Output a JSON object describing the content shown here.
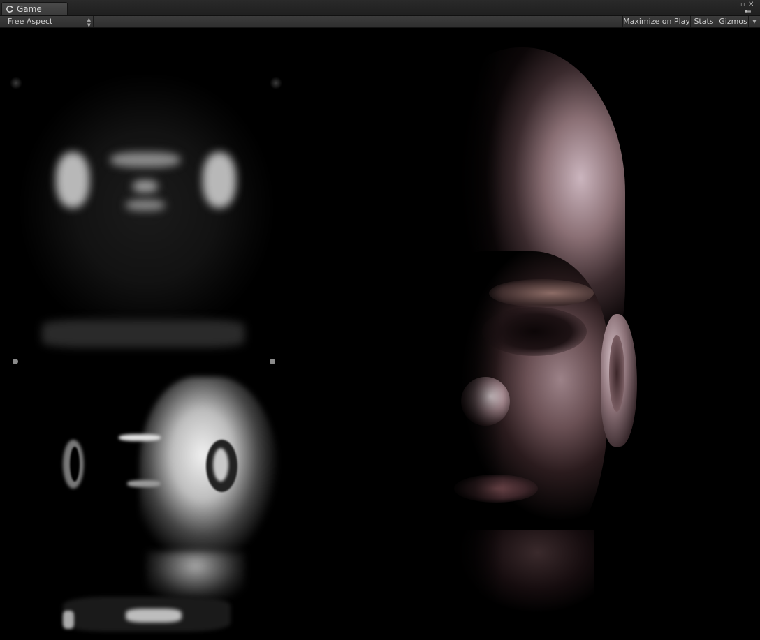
{
  "window": {
    "tab_label": "Game",
    "tab_icon": "unity-game-icon"
  },
  "toolbar": {
    "aspect_label": "Free Aspect",
    "maximize_label": "Maximize on Play",
    "stats_label": "Stats",
    "gizmos_label": "Gizmos"
  },
  "viewport": {
    "scene": "render of bald human head with skin shading debug textures",
    "debug_panels": [
      "blurred-irradiance-texture",
      "specular-normal-texture"
    ]
  },
  "colors": {
    "toolbar_bg": "#353535",
    "tab_bg": "#424242",
    "viewport_bg": "#000000"
  }
}
